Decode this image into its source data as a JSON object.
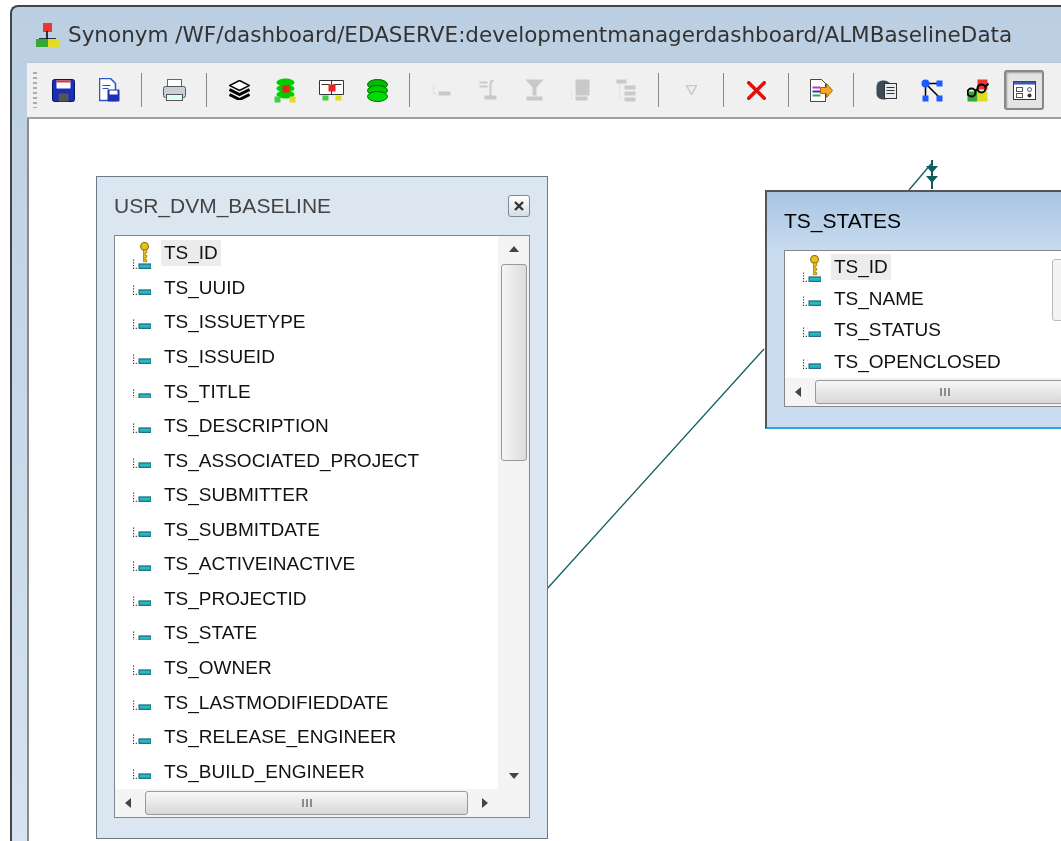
{
  "window": {
    "title": "Synonym /WF/dashboard/EDASERVE:developmentmanagerdashboard/ALMBaselineData"
  },
  "toolbar": [
    {
      "kind": "save",
      "disabled": false,
      "pressed": false
    },
    {
      "kind": "copy",
      "disabled": false,
      "pressed": false
    },
    {
      "kind": "separator"
    },
    {
      "kind": "print",
      "disabled": false,
      "pressed": false
    },
    {
      "kind": "separator"
    },
    {
      "kind": "layers",
      "disabled": false,
      "pressed": false
    },
    {
      "kind": "tree",
      "disabled": false,
      "pressed": false
    },
    {
      "kind": "book",
      "disabled": false,
      "pressed": false
    },
    {
      "kind": "stack",
      "disabled": false,
      "pressed": false
    },
    {
      "kind": "separator"
    },
    {
      "kind": "field",
      "disabled": true,
      "pressed": false
    },
    {
      "kind": "formula",
      "disabled": true,
      "pressed": false
    },
    {
      "kind": "filter",
      "disabled": true,
      "pressed": false
    },
    {
      "kind": "block",
      "disabled": true,
      "pressed": false
    },
    {
      "kind": "outline",
      "disabled": true,
      "pressed": false
    },
    {
      "kind": "separator"
    },
    {
      "kind": "chevron",
      "disabled": true,
      "pressed": false
    },
    {
      "kind": "separator"
    },
    {
      "kind": "delete",
      "disabled": false,
      "pressed": false
    },
    {
      "kind": "separator"
    },
    {
      "kind": "export",
      "disabled": false,
      "pressed": false
    },
    {
      "kind": "separator"
    },
    {
      "kind": "database",
      "disabled": false,
      "pressed": false
    },
    {
      "kind": "network",
      "disabled": false,
      "pressed": false
    },
    {
      "kind": "glasses",
      "disabled": false,
      "pressed": false
    },
    {
      "kind": "properties",
      "disabled": false,
      "pressed": true
    }
  ],
  "tables": [
    {
      "name": "USR_DVM_BASELINE",
      "active": false,
      "closable": true,
      "columns": [
        {
          "name": "TS_ID",
          "kind": "key",
          "selected": true
        },
        {
          "name": "TS_UUID",
          "kind": "field",
          "selected": false
        },
        {
          "name": "TS_ISSUETYPE",
          "kind": "field",
          "selected": false
        },
        {
          "name": "TS_ISSUEID",
          "kind": "field",
          "selected": false
        },
        {
          "name": "TS_TITLE",
          "kind": "field",
          "selected": false
        },
        {
          "name": "TS_DESCRIPTION",
          "kind": "field",
          "selected": false
        },
        {
          "name": "TS_ASSOCIATED_PROJECT",
          "kind": "field",
          "selected": false
        },
        {
          "name": "TS_SUBMITTER",
          "kind": "field",
          "selected": false
        },
        {
          "name": "TS_SUBMITDATE",
          "kind": "field",
          "selected": false
        },
        {
          "name": "TS_ACTIVEINACTIVE",
          "kind": "field",
          "selected": false
        },
        {
          "name": "TS_PROJECTID",
          "kind": "field",
          "selected": false
        },
        {
          "name": "TS_STATE",
          "kind": "field",
          "selected": false
        },
        {
          "name": "TS_OWNER",
          "kind": "field",
          "selected": false
        },
        {
          "name": "TS_LASTMODIFIEDDATE",
          "kind": "field",
          "selected": false
        },
        {
          "name": "TS_RELEASE_ENGINEER",
          "kind": "field",
          "selected": false
        },
        {
          "name": "TS_BUILD_ENGINEER",
          "kind": "field",
          "selected": false
        }
      ]
    },
    {
      "name": "TS_STATES",
      "active": true,
      "closable": false,
      "columns": [
        {
          "name": "TS_ID",
          "kind": "key",
          "selected": true
        },
        {
          "name": "TS_NAME",
          "kind": "field",
          "selected": false
        },
        {
          "name": "TS_STATUS",
          "kind": "field",
          "selected": false
        },
        {
          "name": "TS_OPENCLOSED",
          "kind": "field",
          "selected": false
        }
      ]
    }
  ]
}
